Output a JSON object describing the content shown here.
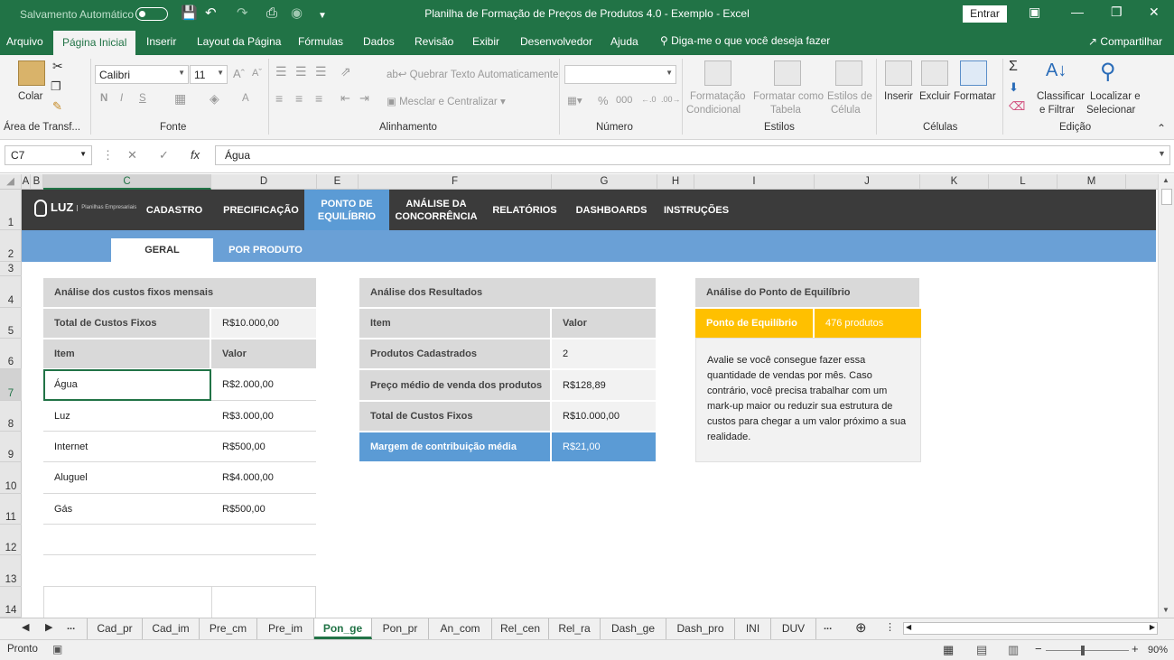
{
  "window": {
    "autosave_label": "Salvamento Automático",
    "title": "Planilha de Formação de Preços de Produtos 4.0 - Exemplo  -  Excel",
    "signin_button": "Entrar"
  },
  "ribbon_tabs": [
    "Arquivo",
    "Página Inicial",
    "Inserir",
    "Layout da Página",
    "Fórmulas",
    "Dados",
    "Revisão",
    "Exibir",
    "Desenvolvedor",
    "Ajuda"
  ],
  "tell_me": "Diga-me o que você deseja fazer",
  "share": "Compartilhar",
  "ribbon": {
    "paste": "Colar",
    "clipboard_group": "Área de Transf...",
    "font_name": "Calibri",
    "font_size": "11",
    "font_group": "Fonte",
    "wrap_text": "Quebrar Texto Automaticamente",
    "merge_center": "Mesclar e Centralizar",
    "alignment_group": "Alinhamento",
    "number_format": "",
    "percent": "%",
    "thousands": "000",
    "number_group": "Número",
    "cond_format_1": "Formatação",
    "cond_format_2": "Condicional",
    "format_table_1": "Formatar como",
    "format_table_2": "Tabela",
    "cell_styles_1": "Estilos de",
    "cell_styles_2": "Célula",
    "styles_group": "Estilos",
    "insert": "Inserir",
    "delete": "Excluir",
    "format": "Formatar",
    "cells_group": "Células",
    "sort_1": "Classificar",
    "sort_2": "e Filtrar",
    "find_1": "Localizar e",
    "find_2": "Selecionar",
    "editing_group": "Edição"
  },
  "formula_bar": {
    "name_box": "C7",
    "fx": "fx",
    "content": "Água"
  },
  "columns": [
    "A",
    "B",
    "C",
    "D",
    "E",
    "F",
    "G",
    "H",
    "I",
    "J",
    "K",
    "L",
    "M"
  ],
  "rows": [
    "1",
    "2",
    "3",
    "4",
    "5",
    "6",
    "7",
    "8",
    "9",
    "10",
    "11",
    "12",
    "13",
    "14"
  ],
  "nav": {
    "logo": "LUZ",
    "logo_sub": "Planilhas Empresariais",
    "items": [
      "CADASTRO",
      "PRECIFICAÇÃO",
      "PONTO DE EQUILÍBRIO",
      "ANÁLISE DA CONCORRÊNCIA",
      "RELATÓRIOS",
      "DASHBOARDS",
      "INSTRUÇÕES"
    ],
    "subtabs": [
      "GERAL",
      "POR PRODUTO"
    ]
  },
  "fixed_costs": {
    "title": "Análise dos custos fixos mensais",
    "total_label": "Total de Custos Fixos",
    "total_value": "R$10.000,00",
    "col_item": "Item",
    "col_value": "Valor",
    "rows": [
      {
        "item": "Água",
        "value": "R$2.000,00"
      },
      {
        "item": "Luz",
        "value": "R$3.000,00"
      },
      {
        "item": "Internet",
        "value": "R$500,00"
      },
      {
        "item": "Aluguel",
        "value": "R$4.000,00"
      },
      {
        "item": "Gás",
        "value": "R$500,00"
      }
    ]
  },
  "results": {
    "title": "Análise dos Resultados",
    "col_item": "Item",
    "col_value": "Valor",
    "rows": [
      {
        "item": "Produtos Cadastrados",
        "value": "2"
      },
      {
        "item": "Preço médio de venda dos produtos",
        "value": "R$128,89"
      },
      {
        "item": "Total de Custos Fixos",
        "value": "R$10.000,00"
      }
    ],
    "margin_label": "Margem de contribuição média",
    "margin_value": "R$21,00"
  },
  "breakeven": {
    "title": "Análise do Ponto de Equilíbrio",
    "label": "Ponto de Equilíbrio",
    "value": "476 produtos",
    "description": "Avalie se você consegue fazer essa quantidade de vendas por mês. Caso contrário, você precisa trabalhar com um mark-up maior ou reduzir sua estrutura de custos para chegar a um valor próximo a sua realidade."
  },
  "sheet_tabs": [
    "Cad_pr",
    "Cad_im",
    "Pre_cm",
    "Pre_im",
    "Pon_ge",
    "Pon_pr",
    "An_com",
    "Rel_cen",
    "Rel_ra",
    "Dash_ge",
    "Dash_pro",
    "INI",
    "DUV"
  ],
  "status": {
    "mode": "Pronto",
    "zoom": "90%"
  }
}
